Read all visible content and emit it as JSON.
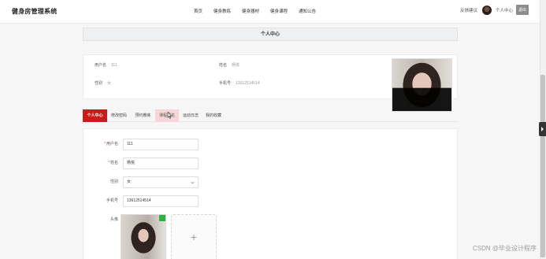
{
  "app": {
    "title": "健身房管理系统"
  },
  "nav": {
    "items": [
      "首页",
      "健身教练",
      "健身器材",
      "健身课程",
      "通知公告"
    ]
  },
  "header_right": {
    "feedback": "反馈建议",
    "user_center": "个人中心",
    "logout": "退出"
  },
  "page": {
    "title": "个人中心"
  },
  "profile": {
    "username_label": "用户名",
    "username": "111",
    "name_label": "姓名",
    "name": "杨悦",
    "gender_label": "性别",
    "gender": "女",
    "phone_label": "手机号",
    "phone": "13612514514"
  },
  "tabs": [
    "个人中心",
    "修改密码",
    "预约教练",
    "课程报名",
    "运动日志",
    "我的收藏"
  ],
  "form": {
    "username_label": "用户名",
    "username": "111",
    "name_label": "姓名",
    "name": "杨悦",
    "gender_label": "性别",
    "gender": "女",
    "phone_label": "手机号",
    "phone": "13612514514",
    "avatar_label": "头像",
    "upload_symbol": "+"
  },
  "watermark": "CSDN @毕业设计程序",
  "colors": {
    "accent": "#c81b1b",
    "tab_hover": "#f6d6d6"
  }
}
